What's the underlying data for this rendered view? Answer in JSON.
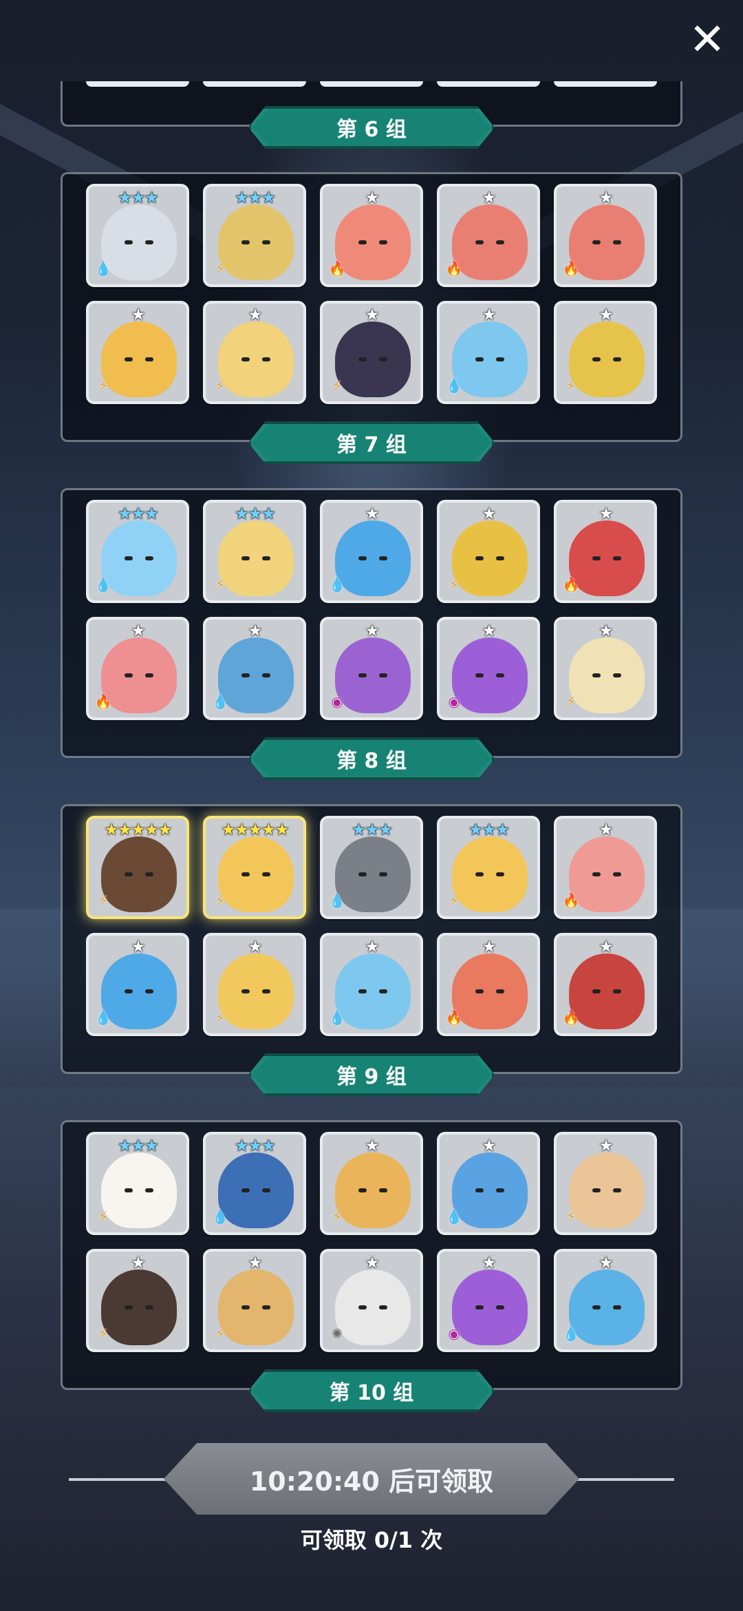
{
  "close_icon": "close-icon",
  "groups": [
    {
      "label": "第 6 组"
    },
    {
      "label": "第 7 组"
    },
    {
      "label": "第 8 组"
    },
    {
      "label": "第 9 组"
    },
    {
      "label": "第 10 组"
    }
  ],
  "panels": [
    {
      "heroes": [
        {
          "stars": "★★★",
          "tier": 3,
          "element": "water",
          "color": "#d9dde6"
        },
        {
          "stars": "★★★",
          "tier": 3,
          "element": "thunder",
          "color": "#e2c56a"
        },
        {
          "stars": "★",
          "tier": 1,
          "element": "fire",
          "color": "#f08a78"
        },
        {
          "stars": "★",
          "tier": 1,
          "element": "fire",
          "color": "#e97f73"
        },
        {
          "stars": "★",
          "tier": 1,
          "element": "fire",
          "color": "#e97f73"
        },
        {
          "stars": "★",
          "tier": 1,
          "element": "thunder",
          "color": "#f0bd4e"
        },
        {
          "stars": "★",
          "tier": 1,
          "element": "thunder",
          "color": "#f2d27a"
        },
        {
          "stars": "★",
          "tier": 1,
          "element": "thunder",
          "color": "#3a3550"
        },
        {
          "stars": "★",
          "tier": 1,
          "element": "water",
          "color": "#7ec7ef"
        },
        {
          "stars": "★",
          "tier": 1,
          "element": "thunder",
          "color": "#e6c34a"
        }
      ]
    },
    {
      "heroes": [
        {
          "stars": "★★★",
          "tier": 3,
          "element": "water",
          "color": "#8fd2f5"
        },
        {
          "stars": "★★★",
          "tier": 3,
          "element": "thunder",
          "color": "#f1d47c"
        },
        {
          "stars": "★",
          "tier": 1,
          "element": "water",
          "color": "#4ea9e6"
        },
        {
          "stars": "★",
          "tier": 1,
          "element": "thunder",
          "color": "#e8c144"
        },
        {
          "stars": "★",
          "tier": 1,
          "element": "fire",
          "color": "#d94c4c"
        },
        {
          "stars": "★",
          "tier": 1,
          "element": "fire",
          "color": "#ee8f92"
        },
        {
          "stars": "★",
          "tier": 1,
          "element": "water",
          "color": "#5fa5d8"
        },
        {
          "stars": "★",
          "tier": 1,
          "element": "dark",
          "color": "#9b63d1"
        },
        {
          "stars": "★",
          "tier": 1,
          "element": "dark",
          "color": "#9d5fd8"
        },
        {
          "stars": "★",
          "tier": 1,
          "element": "thunder",
          "color": "#f1e2b6"
        }
      ]
    },
    {
      "heroes": [
        {
          "stars": "★★★★★",
          "tier": 5,
          "element": "thunder",
          "color": "#6b4a35"
        },
        {
          "stars": "★★★★★",
          "tier": 5,
          "element": "thunder",
          "color": "#f3c65a"
        },
        {
          "stars": "★★★",
          "tier": 3,
          "element": "water",
          "color": "#7b7f88"
        },
        {
          "stars": "★★★",
          "tier": 3,
          "element": "thunder",
          "color": "#f3c65a"
        },
        {
          "stars": "★",
          "tier": 1,
          "element": "fire",
          "color": "#f09a95"
        },
        {
          "stars": "★",
          "tier": 1,
          "element": "water",
          "color": "#4ea9e6"
        },
        {
          "stars": "★",
          "tier": 1,
          "element": "thunder",
          "color": "#f0c85c"
        },
        {
          "stars": "★",
          "tier": 1,
          "element": "water",
          "color": "#7ec7ef"
        },
        {
          "stars": "★",
          "tier": 1,
          "element": "fire",
          "color": "#e9795f"
        },
        {
          "stars": "★",
          "tier": 1,
          "element": "fire",
          "color": "#c8453f"
        }
      ]
    },
    {
      "heroes": [
        {
          "stars": "★★★",
          "tier": 3,
          "element": "thunder",
          "color": "#f8f4ef"
        },
        {
          "stars": "★★★",
          "tier": 3,
          "element": "water",
          "color": "#3d6fb6"
        },
        {
          "stars": "★",
          "tier": 1,
          "element": "thunder",
          "color": "#eab55a"
        },
        {
          "stars": "★",
          "tier": 1,
          "element": "water",
          "color": "#5aa3e2"
        },
        {
          "stars": "★",
          "tier": 1,
          "element": "thunder",
          "color": "#e9c597"
        },
        {
          "stars": "★",
          "tier": 1,
          "element": "thunder",
          "color": "#4a3a33"
        },
        {
          "stars": "★",
          "tier": 1,
          "element": "thunder",
          "color": "#e3b56d"
        },
        {
          "stars": "★",
          "tier": 1,
          "element": "light",
          "color": "#e8e8e8"
        },
        {
          "stars": "★",
          "tier": 1,
          "element": "dark",
          "color": "#9d5fd8"
        },
        {
          "stars": "★",
          "tier": 1,
          "element": "water",
          "color": "#5ab2e6"
        }
      ]
    }
  ],
  "element_icons": {
    "water": {
      "glyph": "💧",
      "color": "#1b88d8"
    },
    "thunder": {
      "glyph": "⚡",
      "color": "#e4a21c"
    },
    "fire": {
      "glyph": "🔥",
      "color": "#e2452c"
    },
    "dark": {
      "glyph": "◉",
      "color": "#b0279d"
    },
    "light": {
      "glyph": "✺",
      "color": "#6c6c6c"
    }
  },
  "claim": {
    "button_label": "10:20:40 后可领取",
    "count_text": "可领取 0/1 次"
  }
}
